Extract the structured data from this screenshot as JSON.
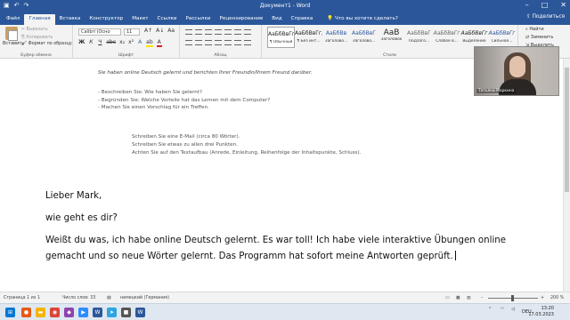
{
  "window": {
    "title": "Документ1  -  Word",
    "controls": [
      "–",
      "□",
      "✕"
    ]
  },
  "tabs": [
    {
      "label": "Файл"
    },
    {
      "label": "Главная"
    },
    {
      "label": "Вставка"
    },
    {
      "label": "Конструктор"
    },
    {
      "label": "Макет"
    },
    {
      "label": "Ссылки"
    },
    {
      "label": "Рассылки"
    },
    {
      "label": "Рецензирование"
    },
    {
      "label": "Вид"
    },
    {
      "label": "Справка"
    }
  ],
  "tell_me": "Что вы хотите сделать?",
  "share": "Поделиться",
  "ribbon": {
    "clipboard": {
      "paste": "Вставить",
      "cut": "Вырезать",
      "copy": "Копировать",
      "format_painter": "Формат по образцу",
      "label": "Буфер обмена"
    },
    "font": {
      "name": "Calibri (Осно",
      "size": "11",
      "label": "Шрифт"
    },
    "paragraph": {
      "label": "Абзац"
    },
    "styles": {
      "label": "Стили",
      "items": [
        {
          "sample": "АаБбВвГг,",
          "name": "¶ Обычный"
        },
        {
          "sample": "АаБбВвГг,",
          "name": "¶ Без инт..."
        },
        {
          "sample": "АаБбВв",
          "name": "Заголово..."
        },
        {
          "sample": "АаБбВвГ",
          "name": "Заголово..."
        },
        {
          "sample": "АаВ",
          "name": "Заголовок"
        },
        {
          "sample": "АаБбВвГ",
          "name": "Подзаго..."
        },
        {
          "sample": "АаБбВвГг",
          "name": "Слабое в..."
        },
        {
          "sample": "АаБбВвГг",
          "name": "Выделение"
        },
        {
          "sample": "АаБбВвГг",
          "name": "Сильное..."
        }
      ]
    },
    "editing": {
      "find": "Найти",
      "replace": "Заменить",
      "select": "Выделить"
    }
  },
  "document": {
    "task_intro": "Sie haben online Deutsch gelernt und berichten Ihrer Freundin/Ihrem Freund darüber.",
    "task_points": [
      "- Beschreiben Sie: Wie haben Sie gelernt?",
      "- Begründen Sie: Welche Vorteile hat das Lernen mit dem Computer?",
      "- Machen Sie einen Vorschlag für ein Treffen."
    ],
    "instructions": [
      "Schreiben Sie eine E-Mail (circa 80 Wörter).",
      "Schreiben Sie etwas zu allen drei Punkten.",
      "Achten Sie auf den Textaufbau (Anrede, Einleitung, Reihenfolge der Inhaltspunkte, Schluss)."
    ],
    "letter": {
      "greeting": "Lieber Mark,",
      "question": "wie geht es dir?",
      "paragraph_line1": "Weißt du was, ich habe online Deutsch gelernt. Es war toll! Ich habe viele interaktive Übungen online",
      "paragraph_line2": "gemacht und so neue Wörter gelernt. Das Programm hat sofort meine Antworten geprüft."
    }
  },
  "webcam": {
    "caption": "Татьяна Маркина"
  },
  "statusbar": {
    "page": "Страница 1 из 1",
    "words": "Число слов: 33",
    "language": "немецкий (Германия)",
    "zoom": "200 %"
  },
  "taskbar": {
    "language": "DEU",
    "time": "13:20",
    "date": "17.03.2023"
  }
}
